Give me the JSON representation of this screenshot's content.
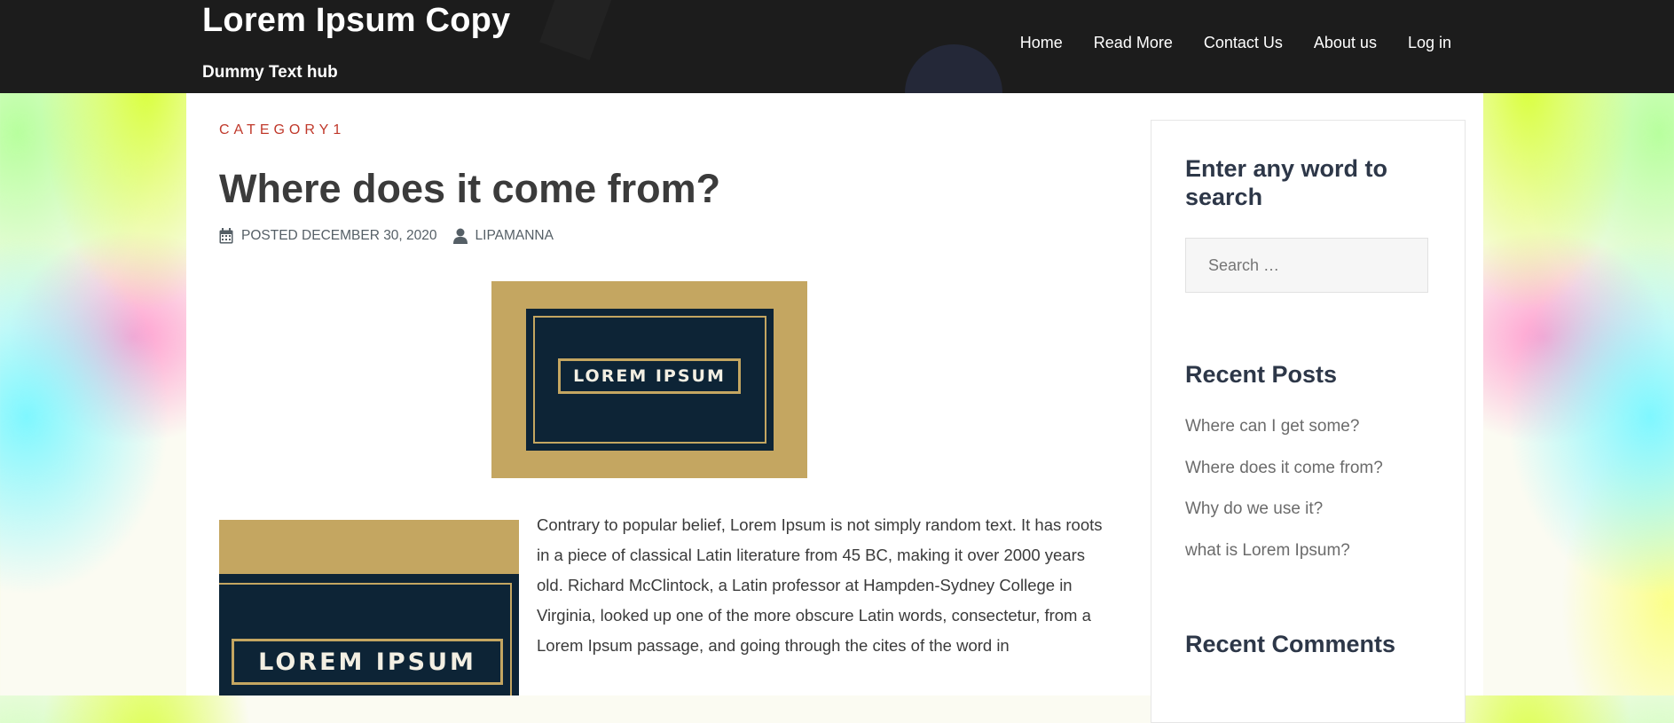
{
  "header": {
    "site_title": "Lorem Ipsum Copy",
    "tagline": "Dummy Text hub",
    "nav": [
      "Home",
      "Read More",
      "Contact Us",
      "About us",
      "Log in"
    ]
  },
  "post": {
    "category": "CATEGORY1",
    "title": "Where does it come from?",
    "posted": "POSTED DECEMBER 30, 2020",
    "author": "LIPAMANNA",
    "image_label": "LOREM IPSUM",
    "body": "Contrary to popular belief, Lorem Ipsum is not simply random text. It has roots in a piece of classical Latin literature from 45 BC, making it over 2000 years old. Richard McClintock, a Latin professor at Hampden-Sydney College in Virginia, looked up one of the more obscure Latin words, consectetur, from a Lorem Ipsum passage, and going through the cites of the word in"
  },
  "sidebar": {
    "search_title": "Enter any word to search",
    "search_placeholder": "Search …",
    "recent_posts_title": "Recent Posts",
    "recent_posts": [
      "Where can I get some?",
      "Where does it come from?",
      "Why do we use it?",
      "what is Lorem Ipsum?"
    ],
    "recent_comments_title": "Recent Comments"
  },
  "colors": {
    "header_bg": "#1c1c1c",
    "category": "#c0392b",
    "logo_gold": "#c4a661",
    "logo_navy": "#0d2436"
  }
}
